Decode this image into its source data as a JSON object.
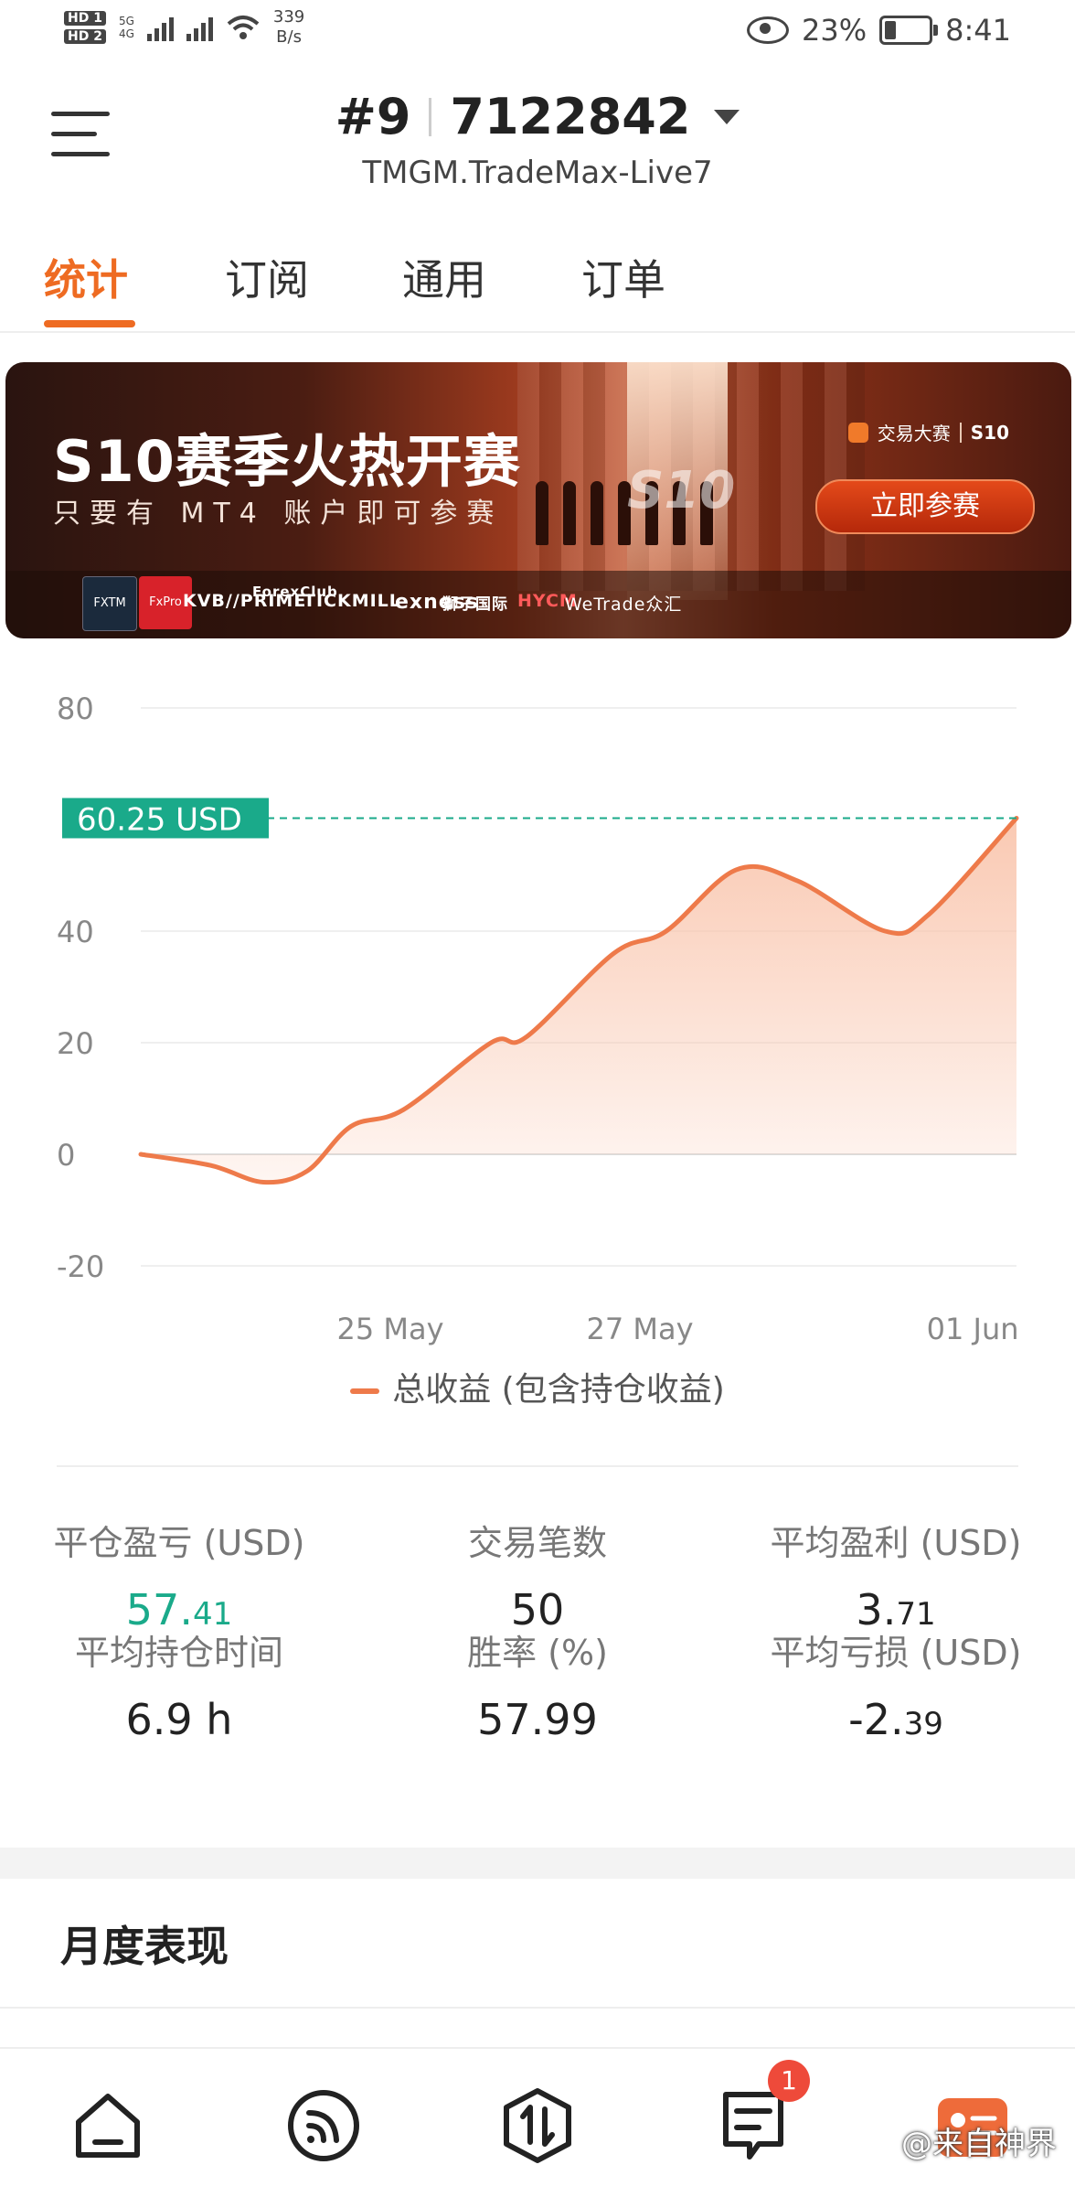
{
  "status_bar": {
    "hd1": "HD 1",
    "hd2": "HD 2",
    "net1": "5G",
    "net2": "4G",
    "speed_value": "339",
    "speed_unit": "B/s",
    "battery": "23%",
    "time": "8:41"
  },
  "header": {
    "account_prefix": "#9",
    "account_number": "7122842",
    "server": "TMGM.TradeMax-Live7"
  },
  "tabs": [
    {
      "label": "统计",
      "active": true
    },
    {
      "label": "订阅",
      "active": false
    },
    {
      "label": "通用",
      "active": false
    },
    {
      "label": "订单",
      "active": false
    }
  ],
  "banner": {
    "title": "S10赛季火热开赛",
    "subtitle": "只要有 MT4 账户即可参赛",
    "badge_left": "交易大赛",
    "badge_right": "S10",
    "season_mark": "S10",
    "cta": "立即参赛",
    "sponsors": [
      "FXTM",
      "FxPro",
      "KVB//PRIME",
      "ForexClub",
      "TICKMILL",
      "exness",
      "獅子国际",
      "HYCM",
      "WeTrade众汇"
    ]
  },
  "chart_data": {
    "type": "area",
    "y_ticks": [
      "80",
      "40",
      "20",
      "0",
      "-20"
    ],
    "ylim": [
      -20,
      80
    ],
    "x_tick_labels": [
      "25 May",
      "27 May",
      "01 Jun"
    ],
    "series": [
      {
        "name": "总收益 (包含持仓收益)",
        "points": [
          [
            0,
            0
          ],
          [
            0.08,
            -2
          ],
          [
            0.14,
            -5
          ],
          [
            0.19,
            -3
          ],
          [
            0.24,
            5
          ],
          [
            0.3,
            8
          ],
          [
            0.4,
            20
          ],
          [
            0.44,
            21
          ],
          [
            0.54,
            36
          ],
          [
            0.6,
            40
          ],
          [
            0.68,
            51
          ],
          [
            0.75,
            49
          ],
          [
            0.85,
            40
          ],
          [
            0.9,
            43
          ],
          [
            1,
            60.25
          ]
        ]
      }
    ],
    "current_value_label": "60.25 USD",
    "current_value": 60.25,
    "colors": {
      "line": "#ee7a4a",
      "fill": "#f9c3aa",
      "marker": "#1aaa8a"
    }
  },
  "legend": {
    "label": "总收益 (包含持仓收益)"
  },
  "stats": [
    {
      "label": "平仓盈亏 (USD)",
      "int": "57.",
      "dec": "41",
      "green": true
    },
    {
      "label": "交易笔数",
      "int": "50",
      "dec": "",
      "green": false
    },
    {
      "label": "平均盈利 (USD)",
      "int": "3.",
      "dec": "71",
      "green": false
    },
    {
      "label": "平均持仓时间",
      "int": "6.9 h",
      "dec": "",
      "green": false
    },
    {
      "label": "胜率 (%)",
      "int": "57.99",
      "dec": "",
      "green": false
    },
    {
      "label": "平均亏损 (USD)",
      "int": "-2.",
      "dec": "39",
      "green": false
    }
  ],
  "monthly": {
    "title": "月度表现"
  },
  "bottom_nav": {
    "items": [
      {
        "icon": "home-icon"
      },
      {
        "icon": "signal-feed-icon"
      },
      {
        "icon": "trade-icon"
      },
      {
        "icon": "orders-icon",
        "badge": "1"
      },
      {
        "icon": "profile-card-icon"
      }
    ],
    "watermark": "@来自神界"
  }
}
